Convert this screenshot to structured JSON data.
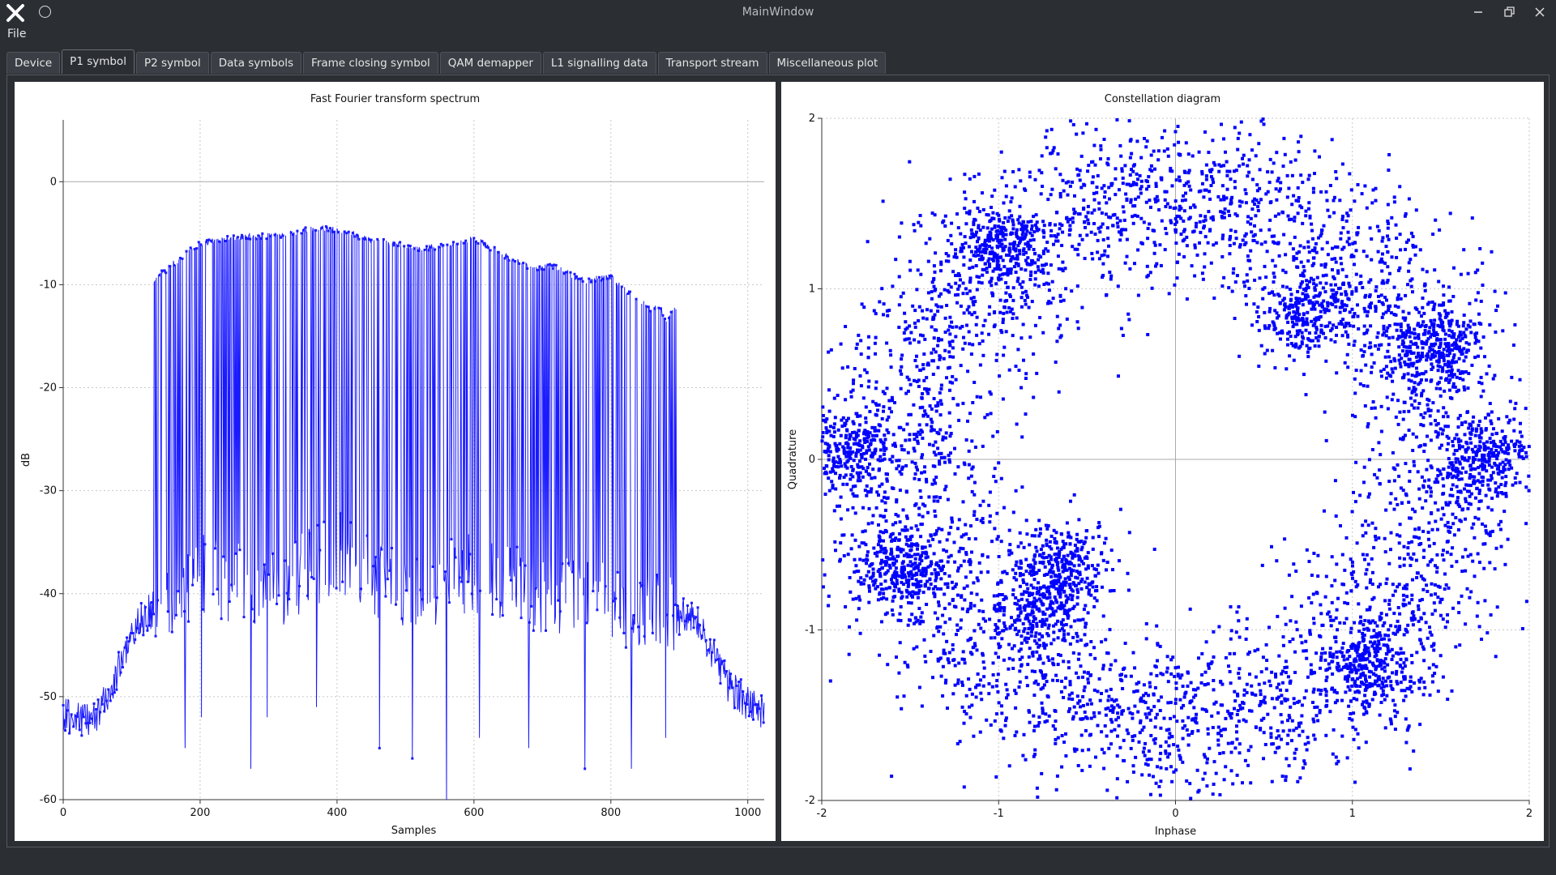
{
  "window": {
    "title": "MainWindow"
  },
  "menu": {
    "file": "File"
  },
  "tabs": [
    "Device",
    "P1 symbol",
    "P2 symbol",
    "Data symbols",
    "Frame closing symbol",
    "QAM demapper",
    "L1 signalling data",
    "Transport stream",
    "Miscellaneous plot"
  ],
  "active_tab": "P1 symbol",
  "chart_data": [
    {
      "type": "line",
      "title": "Fast Fourier transform spectrum",
      "xlabel": "Samples",
      "ylabel": "dB",
      "xlim": [
        0,
        1024
      ],
      "ylim": [
        -60,
        6
      ],
      "xticks": [
        0,
        200,
        400,
        600,
        800,
        1000
      ],
      "yticks": [
        0,
        -10,
        -20,
        -30,
        -40,
        -50,
        -60
      ],
      "grid": true,
      "color": "#1a1aff",
      "series": [
        {
          "envelope_upper": [
            [
              0,
              -50
            ],
            [
              40,
              -50.5
            ],
            [
              60,
              -49
            ],
            [
              90,
              -44
            ],
            [
              110,
              -41
            ],
            [
              125,
              -40
            ],
            [
              130,
              -40
            ],
            [
              131,
              -9.6
            ],
            [
              160,
              -8
            ],
            [
              200,
              -6
            ],
            [
              240,
              -5.5
            ],
            [
              280,
              -5.3
            ],
            [
              320,
              -5.2
            ],
            [
              360,
              -4.6
            ],
            [
              400,
              -4.6
            ],
            [
              440,
              -5.5
            ],
            [
              480,
              -6
            ],
            [
              520,
              -6.5
            ],
            [
              560,
              -6.2
            ],
            [
              600,
              -5.5
            ],
            [
              640,
              -7
            ],
            [
              680,
              -8.3
            ],
            [
              720,
              -8.3
            ],
            [
              760,
              -9.6
            ],
            [
              800,
              -9.2
            ],
            [
              820,
              -10.5
            ],
            [
              840,
              -11.5
            ],
            [
              860,
              -12.4
            ],
            [
              870,
              -12.1
            ],
            [
              880,
              -13.4
            ],
            [
              895,
              -12.3
            ],
            [
              896,
              -40.5
            ],
            [
              920,
              -40.4
            ],
            [
              950,
              -44
            ],
            [
              970,
              -47
            ],
            [
              1000,
              -49
            ],
            [
              1024,
              -50
            ]
          ],
          "envelope_lower": [
            [
              131,
              -51
            ],
            [
              200,
              -48
            ],
            [
              300,
              -50
            ],
            [
              400,
              -46
            ],
            [
              500,
              -50
            ],
            [
              600,
              -48
            ],
            [
              700,
              -50
            ],
            [
              800,
              -51
            ],
            [
              895,
              -52
            ]
          ],
          "deep_nulls": [
            [
              127,
              -54
            ],
            [
              178,
              -55
            ],
            [
              202,
              -52
            ],
            [
              274,
              -57
            ],
            [
              298,
              -52
            ],
            [
              370,
              -51
            ],
            [
              462,
              -55
            ],
            [
              510,
              -56
            ],
            [
              560,
              -60
            ],
            [
              608,
              -54
            ],
            [
              680,
              -55
            ],
            [
              762,
              -57
            ],
            [
              830,
              -57
            ],
            [
              880,
              -54
            ]
          ]
        }
      ]
    },
    {
      "type": "scatter",
      "title": "Constellation diagram",
      "xlabel": "Inphase",
      "ylabel": "Quadrature",
      "xlim": [
        -2,
        2
      ],
      "ylim": [
        -2,
        2
      ],
      "xticks": [
        -2,
        -1,
        0,
        1,
        2
      ],
      "yticks": [
        2,
        1,
        0,
        -1,
        -2
      ],
      "grid": true,
      "color": "#0000ff",
      "series": [
        {
          "ring_radius_mean": 1.55,
          "ring_radius_spread": 0.25,
          "dense_clusters": [
            [
              -1.0,
              1.25
            ],
            [
              -1.55,
              -0.65
            ],
            [
              -0.75,
              -0.85
            ],
            [
              -0.65,
              -0.6
            ],
            [
              0.75,
              0.85
            ],
            [
              1.45,
              0.65
            ],
            [
              1.1,
              -1.2
            ],
            [
              1.75,
              0
            ],
            [
              -1.85,
              0.05
            ]
          ],
          "point_count": 6500
        }
      ]
    }
  ]
}
